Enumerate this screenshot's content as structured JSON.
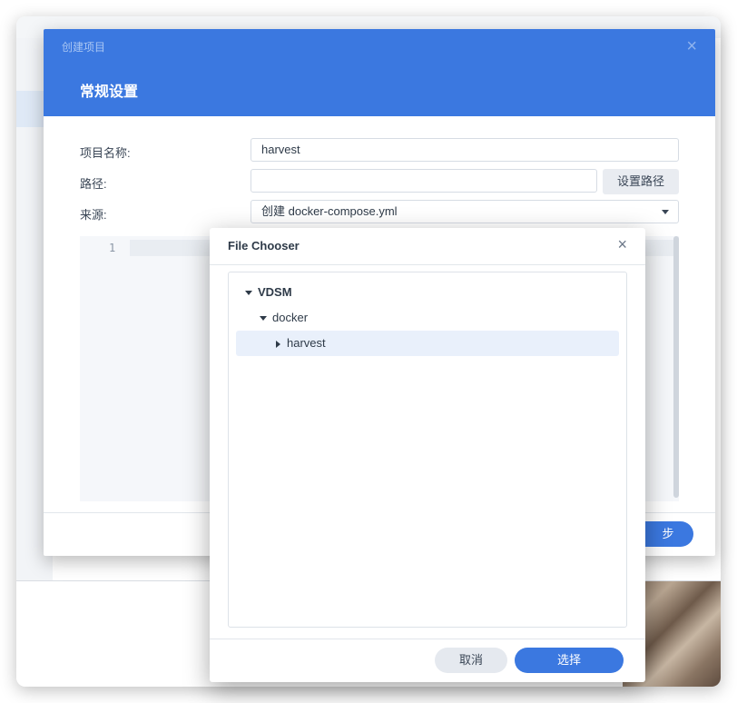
{
  "dialog": {
    "title_small": "创建项目",
    "title": "常规设置",
    "close_glyph": "×",
    "form": {
      "name_label": "项目名称:",
      "name_value": "harvest",
      "path_label": "路径:",
      "path_value": "",
      "set_path_button": "设置路径",
      "source_label": "来源:",
      "source_value": "创建 docker-compose.yml"
    },
    "editor": {
      "line_number": "1"
    },
    "next_button_partial": "步"
  },
  "file_chooser": {
    "title": "File Chooser",
    "close_glyph": "×",
    "tree": [
      {
        "label": "VDSM",
        "expanded": true
      },
      {
        "label": "docker",
        "expanded": true
      },
      {
        "label": "harvest",
        "expanded": false,
        "selected": true
      }
    ],
    "cancel_button": "取消",
    "select_button": "选择"
  },
  "colors": {
    "accent": "#3b78e0",
    "selected_row": "#e9f0fb"
  }
}
